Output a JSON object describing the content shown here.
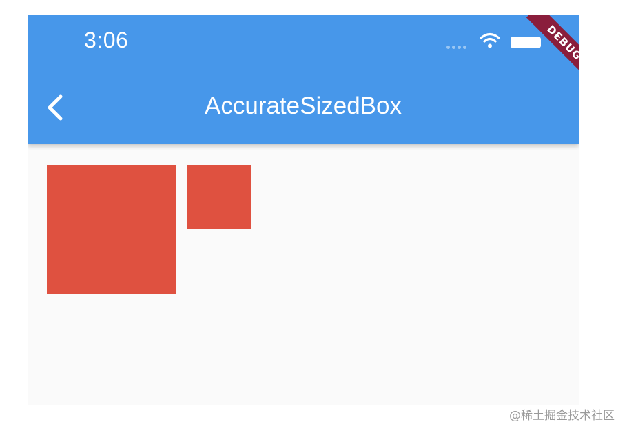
{
  "status_bar": {
    "time": "3:06",
    "icons": [
      "signal-dots",
      "wifi-icon",
      "battery-icon"
    ]
  },
  "debug_banner": {
    "label": "DEBUG",
    "color": "#8a1e3c"
  },
  "app_bar": {
    "title": "AccurateSizedBox",
    "back_icon": "chevron-left-icon",
    "color": "#4797ea"
  },
  "content": {
    "boxes": [
      {
        "name": "large-red-box",
        "color": "#df5140"
      },
      {
        "name": "small-red-box",
        "color": "#df5140"
      }
    ]
  },
  "watermark": "@稀土掘金技术社区"
}
